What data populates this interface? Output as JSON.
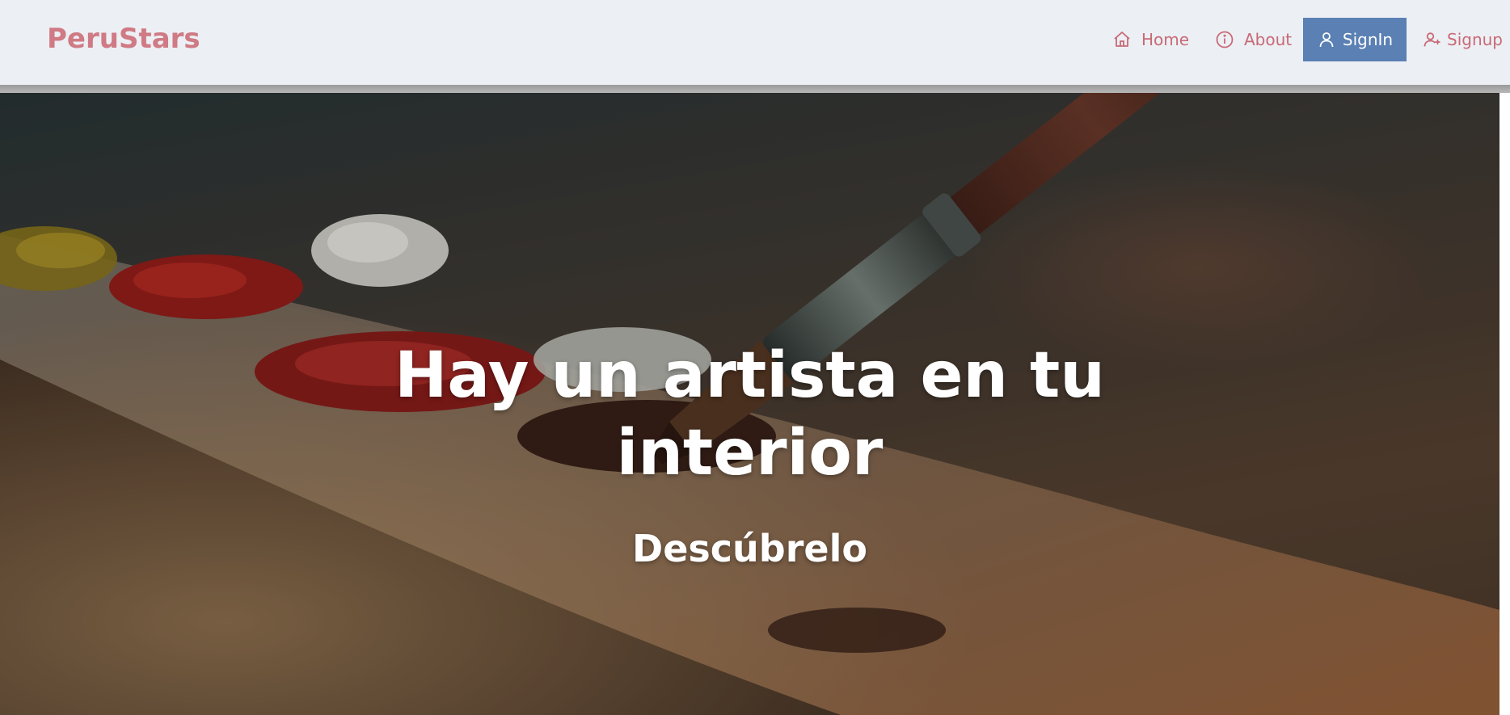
{
  "navbar": {
    "brand": "PeruStars",
    "items": [
      {
        "label": "Home",
        "icon": "home-icon"
      },
      {
        "label": "About",
        "icon": "info-icon"
      },
      {
        "label": "SignIn",
        "icon": "user-icon"
      },
      {
        "label": "Signup",
        "icon": "user-plus-icon"
      }
    ],
    "active_item": "SignIn"
  },
  "hero": {
    "title": "Hay un artista en tu interior",
    "subtitle": "Descúbrelo",
    "background": "paint-palette-with-brush-photo"
  },
  "colors": {
    "brand": "#cf7a84",
    "nav_text": "#c86a76",
    "active_bg": "#5a80b4",
    "navbar_bg": "#eceff4"
  }
}
